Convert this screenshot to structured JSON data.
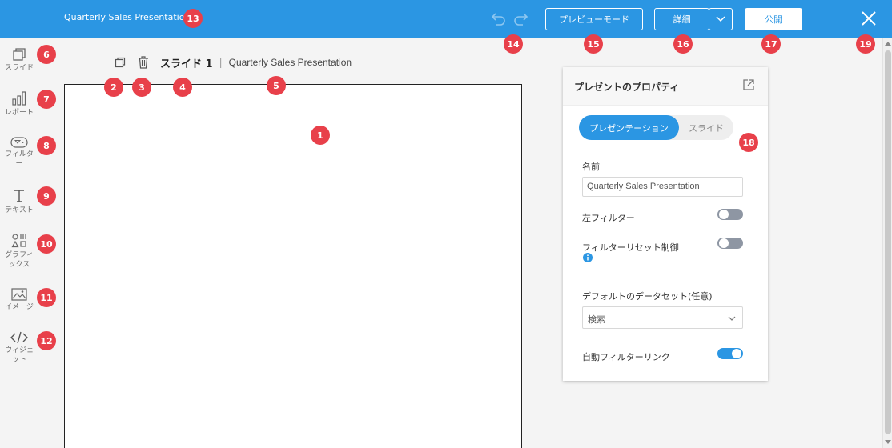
{
  "header": {
    "title": "Quarterly Sales Presentation",
    "preview_label": "プレビューモード",
    "detail_label": "詳細",
    "publish_label": "公開"
  },
  "sidebar": {
    "items": [
      {
        "label": "スライド",
        "icon": "slide-icon"
      },
      {
        "label": "レポート",
        "icon": "report-icon"
      },
      {
        "label": "フィルター",
        "icon": "filter-icon"
      },
      {
        "label": "テキスト",
        "icon": "text-icon"
      },
      {
        "label": "グラフィックス",
        "icon": "graphics-icon"
      },
      {
        "label": "イメージ",
        "icon": "image-icon"
      },
      {
        "label": "ウィジェット",
        "icon": "widget-icon"
      }
    ]
  },
  "slide": {
    "number_label": "スライド 1",
    "separator": "|",
    "presentation_name": "Quarterly Sales Presentation"
  },
  "props": {
    "title": "プレゼントのプロパティ",
    "tabs": [
      "プレゼンテーション",
      "スライド"
    ],
    "name_label": "名前",
    "name_value": "Quarterly Sales Presentation",
    "left_filter_label": "左フィルター",
    "left_filter_on": false,
    "filter_reset_label": "フィルターリセット制御",
    "filter_reset_on": false,
    "default_dataset_label": "デフォルトのデータセット(任意)",
    "dataset_placeholder": "検索",
    "auto_filter_link_label": "自動フィルターリンク",
    "auto_filter_link_on": true
  },
  "colors": {
    "accent": "#2b96e3",
    "badge": "#e8404a"
  },
  "badges": [
    "1",
    "2",
    "3",
    "4",
    "5",
    "6",
    "7",
    "8",
    "9",
    "10",
    "11",
    "12",
    "13",
    "14",
    "15",
    "16",
    "17",
    "18",
    "19"
  ]
}
